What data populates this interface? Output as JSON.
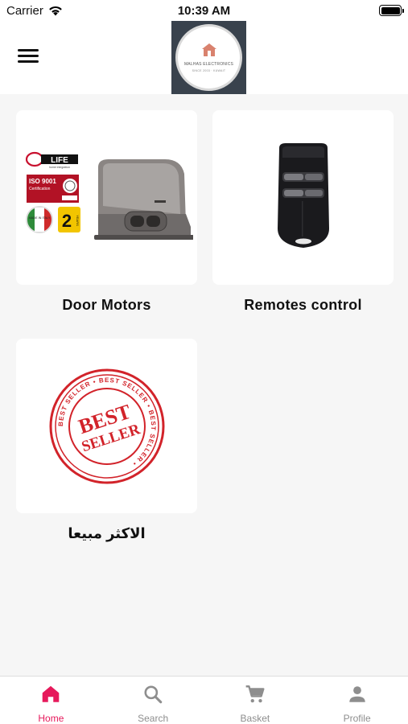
{
  "status_bar": {
    "carrier": "Carrier",
    "time": "10:39 AM"
  },
  "header": {
    "logo_name": "MALHAS ELECTRONICS",
    "logo_sub": "SINCE 2003 · KUWAIT"
  },
  "categories": [
    {
      "label": "Door Motors",
      "badges": {
        "brand": "LIFE",
        "brand_tag": "home integration",
        "iso": "ISO 9001",
        "iso_sub": "Certification",
        "made_in": "MADE IN ITALY",
        "warranty": "2",
        "warranty_unit": "YEARS"
      }
    },
    {
      "label": "Remotes control"
    },
    {
      "label": "الاكثر مبيعا",
      "stamp": {
        "main_top": "BEST",
        "main_bottom": "SELLER",
        "ring": "BEST SELLER • BEST SELLER • BEST SELLER • "
      }
    }
  ],
  "tabbar": {
    "active_color": "#e6195b",
    "inactive_color": "#8e8e8e",
    "tabs": [
      {
        "label": "Home",
        "icon": "home-icon",
        "active": true
      },
      {
        "label": "Search",
        "icon": "search-icon",
        "active": false
      },
      {
        "label": "Basket",
        "icon": "cart-icon",
        "active": false
      },
      {
        "label": "Profile",
        "icon": "person-icon",
        "active": false
      }
    ]
  }
}
